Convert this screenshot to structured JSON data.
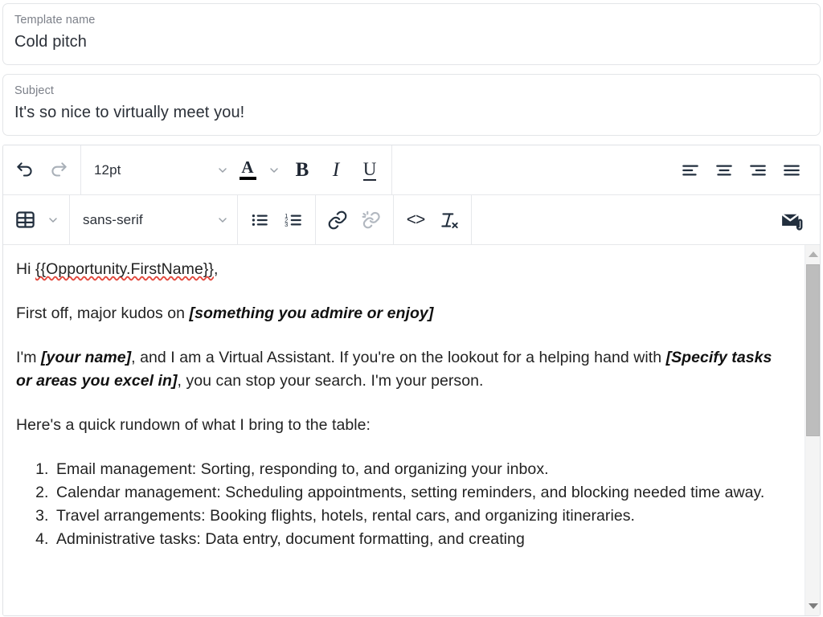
{
  "template_name_field": {
    "label": "Template name",
    "value": "Cold pitch"
  },
  "subject_field": {
    "label": "Subject",
    "value": "It's so nice to virtually meet you!"
  },
  "toolbar": {
    "row1": {
      "undo": "undo-icon",
      "redo": "redo-icon",
      "font_size": "12pt",
      "text_color_glyph": "A",
      "text_color_value": "#000000",
      "bold": "B",
      "italic": "I",
      "underline": "U",
      "align_left": "align-left-icon",
      "align_center": "align-center-icon",
      "align_right": "align-right-icon",
      "align_justify": "align-justify-icon"
    },
    "row2": {
      "table": "table-icon",
      "font_family": "sans-serif",
      "bullet_list": "bullet-list-icon",
      "numbered_list": "numbered-list-icon",
      "link": "link-icon",
      "unlink": "unlink-icon",
      "source_code": "<>",
      "clear_formatting": "clear-formatting-icon",
      "attach_email": "email-attachment-icon"
    }
  },
  "body": {
    "greeting_prefix": "Hi ",
    "greeting_merge_field": "{{Opportunity.FirstName}}",
    "greeting_suffix": ",",
    "p2_prefix": "First off, major kudos on ",
    "p2_placeholder": "[something you admire or enjoy]",
    "p3_a": "I'm ",
    "p3_ph1": "[your name]",
    "p3_b": ", and I am a Virtual Assistant. If you're on the lookout for a helping hand with ",
    "p3_ph2": "[Specify tasks or areas you excel in]",
    "p3_c": ", you can stop your search. I'm your person.",
    "p4": "Here's a quick rundown of what I bring to the table:",
    "list": [
      "Email management: Sorting, responding to, and organizing your inbox.",
      "Calendar management: Scheduling appointments, setting reminders, and blocking needed time away.",
      "Travel arrangements: Booking flights, hotels, rental cars, and organizing itineraries.",
      "Administrative tasks: Data entry, document formatting, and creating"
    ]
  },
  "scrollbar": {
    "up_arrow": "scroll-up-icon",
    "down_arrow": "scroll-down-icon"
  }
}
